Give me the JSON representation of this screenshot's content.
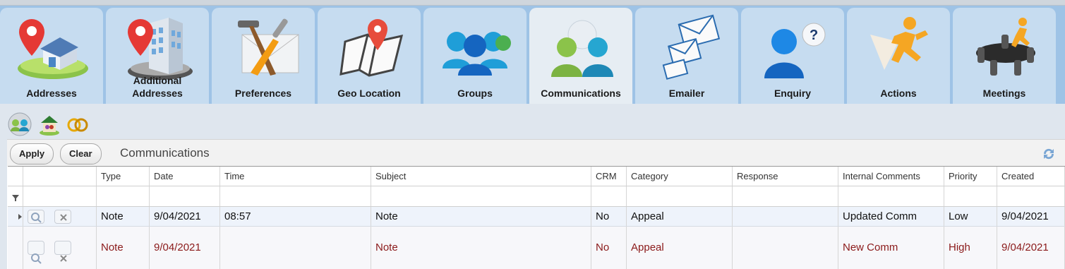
{
  "tabs": [
    {
      "label": "Addresses",
      "icon": "map-pin-house-icon"
    },
    {
      "label": "Additional Addresses",
      "icon": "map-pin-building-icon"
    },
    {
      "label": "Preferences",
      "icon": "tools-envelope-icon"
    },
    {
      "label": "Geo Location",
      "icon": "map-location-icon"
    },
    {
      "label": "Groups",
      "icon": "people-group-icon"
    },
    {
      "label": "Communications",
      "icon": "people-chat-icon"
    },
    {
      "label": "Emailer",
      "icon": "envelopes-icon"
    },
    {
      "label": "Enquiry",
      "icon": "person-question-icon"
    },
    {
      "label": "Actions",
      "icon": "running-person-icon"
    },
    {
      "label": "Meetings",
      "icon": "meeting-table-icon"
    }
  ],
  "active_tab": "Communications",
  "toolbar": {
    "apply_label": "Apply",
    "clear_label": "Clear",
    "title": "Communications"
  },
  "grid": {
    "columns": [
      "Type",
      "Date",
      "Time",
      "Subject",
      "CRM",
      "Category",
      "Response",
      "Internal Comments",
      "Priority",
      "Created"
    ],
    "rows": [
      {
        "type": "Note",
        "date": "9/04/2021",
        "time": "08:57",
        "subject": "Note",
        "crm": "No",
        "category": "Appeal",
        "response": "",
        "internal_comments": "Updated Comm",
        "priority": "Low",
        "created": "9/04/2021"
      },
      {
        "type": "Note",
        "date": "9/04/2021",
        "time": "",
        "subject": "Note",
        "crm": "No",
        "category": "Appeal",
        "response": "",
        "internal_comments": "New Comm",
        "priority": "High",
        "created": "9/04/2021"
      }
    ]
  },
  "colors": {
    "tab_bg": "#c6dcf0",
    "tab_active": "#e6edf3",
    "strip": "#9ec3e6",
    "alt_row_text": "#8b1a1a"
  }
}
